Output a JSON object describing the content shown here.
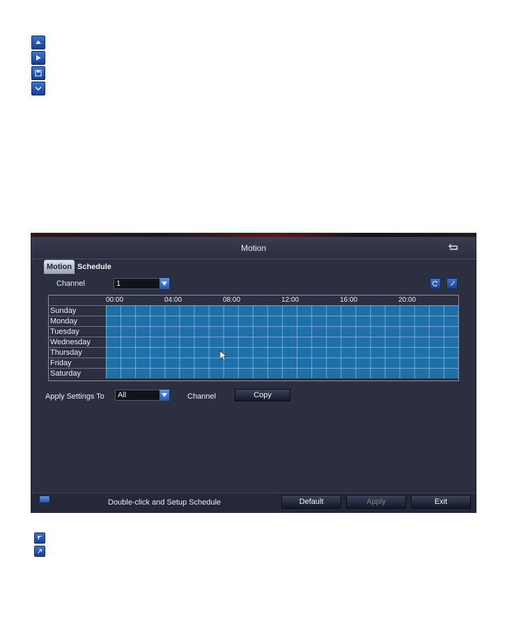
{
  "window": {
    "title": "Motion"
  },
  "tabs": [
    {
      "label": "Motion",
      "active": true
    },
    {
      "label": "Schedule",
      "active": false
    }
  ],
  "channel": {
    "label": "Channel",
    "value": "1"
  },
  "schedule": {
    "hours": [
      "00:00",
      "04:00",
      "08:00",
      "12:00",
      "16:00",
      "20:00"
    ],
    "days": [
      "Sunday",
      "Monday",
      "Tuesday",
      "Wednesday",
      "Thursday",
      "Friday",
      "Saturday"
    ]
  },
  "apply": {
    "label": "Apply Settings To",
    "value": "All",
    "channel_label": "Channel",
    "copy_label": "Copy"
  },
  "status": {
    "text": "Double-click and Setup Schedule"
  },
  "buttons": {
    "default": "Default",
    "apply": "Apply",
    "exit": "Exit"
  },
  "colors": {
    "grid_fill": "#1f6fa8",
    "panel_bg": "#2c2f40",
    "accent": "#2557b2"
  },
  "icons": {
    "legend": [
      "up-arrow-icon",
      "right-arrow-icon",
      "save-icon",
      "down-chevron-icon"
    ],
    "footer": [
      "back-arrow-icon",
      "forward-arrow-icon"
    ],
    "toolbar": [
      "reset-icon",
      "edit-icon"
    ]
  }
}
